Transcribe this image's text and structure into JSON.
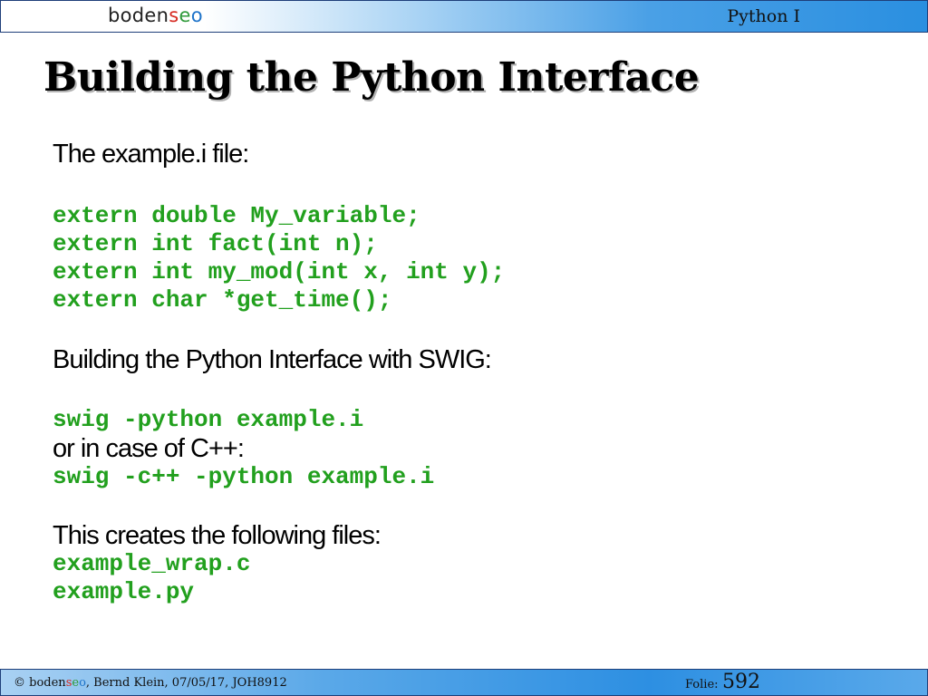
{
  "header": {
    "logo": {
      "part1": "boden",
      "s": "s",
      "e": "e",
      "o": "o"
    },
    "course": "Python I"
  },
  "slide": {
    "title": "Building the Python Interface",
    "intro": "The example.i file:",
    "code_lines": [
      "extern double My_variable;",
      "extern int fact(int n);",
      "extern int my_mod(int x, int y);",
      "extern char *get_time();"
    ],
    "swig_heading": "Building the Python Interface with SWIG:",
    "swig_command": "swig -python example.i",
    "cpp_note": "or in case of C++:",
    "swig_cpp_command": "swig -c++ -python example.i",
    "files_heading": "This creates the following files:",
    "files": [
      "example_wrap.c",
      "example.py"
    ]
  },
  "footer": {
    "copyright": "©",
    "brand": {
      "part1": "boden",
      "s": "s",
      "e": "e",
      "o": "o"
    },
    "author_date": ", Bernd Klein, 07/05/17, JOH8912",
    "folie_label": "Folie:",
    "folie_number": "592"
  },
  "colors": {
    "code": "#22a01e",
    "text": "#000000",
    "logo_s": "#d6281f",
    "logo_e": "#2f9a3a",
    "logo_o": "#1e73c9",
    "bar_blue": "#2d8fe2"
  }
}
